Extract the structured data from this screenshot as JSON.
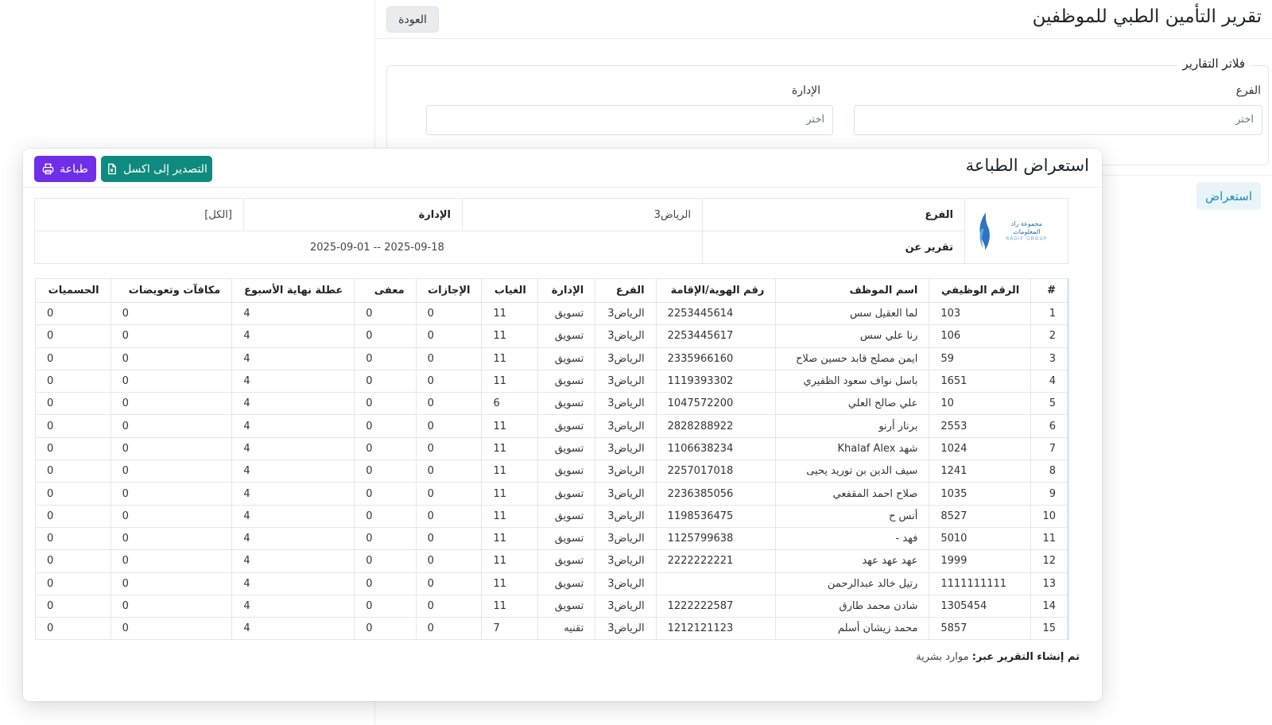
{
  "page": {
    "title": "تقرير التأمين الطبي للموظفين",
    "back_label": "العودة",
    "filters_title": "فلاتر التقارير",
    "branch_label": "الفرع",
    "branch_placeholder": "اختر",
    "department_label": "الإدارة",
    "department_placeholder": "اختر",
    "view_label": "استعراض"
  },
  "modal": {
    "title": "استعراض الطباعة",
    "export_label": "التصدير إلى اكسل",
    "print_label": "طباعة",
    "logo": {
      "line1": "مجموعة راد المعلومات",
      "line2": "RADIF GROUP"
    },
    "info": {
      "branch_label": "الفرع",
      "branch_value": "الرياض3",
      "department_label": "الإدارة",
      "department_value": "[الكل]",
      "report_for_label": "تقرير عن",
      "report_for_value": "2025-09-01 -- 2025-09-18"
    },
    "columns": [
      "#",
      "الرقم الوظيفي",
      "اسم الموظف",
      "رقم الهوية/الإقامة",
      "الفرع",
      "الإدارة",
      "الغياب",
      "الإجازات",
      "معفى",
      "عطلة نهاية الأسبوع",
      "مكافآت وتعويضات",
      "الحسميات"
    ],
    "rows": [
      [
        "1",
        "103",
        "لما العقيل سس",
        "2253445614",
        "الرياض3",
        "تسويق",
        "11",
        "0",
        "0",
        "4",
        "0",
        "0"
      ],
      [
        "2",
        "106",
        "رنا علي سس",
        "2253445617",
        "الرياض3",
        "تسويق",
        "11",
        "0",
        "0",
        "4",
        "0",
        "0"
      ],
      [
        "3",
        "59",
        "ايمن مصلح قابد حسين صلاح",
        "2335966160",
        "الرياض3",
        "تسويق",
        "11",
        "0",
        "0",
        "4",
        "0",
        "0"
      ],
      [
        "4",
        "1651",
        "باسل نواف سعود الظفيري",
        "1119393302",
        "الرياض3",
        "تسويق",
        "11",
        "0",
        "0",
        "4",
        "0",
        "0"
      ],
      [
        "5",
        "10",
        "علي صالح العلي",
        "1047572200",
        "الرياض3",
        "تسويق",
        "6",
        "0",
        "0",
        "4",
        "0",
        "0"
      ],
      [
        "6",
        "2553",
        "برنار أرنو",
        "2828288922",
        "الرياض3",
        "تسويق",
        "11",
        "0",
        "0",
        "4",
        "0",
        "0"
      ],
      [
        "7",
        "1024",
        "شهد Khalaf Alex",
        "1106638234",
        "الرياض3",
        "تسويق",
        "11",
        "0",
        "0",
        "4",
        "0",
        "0"
      ],
      [
        "8",
        "1241",
        "سيف الدين بن توريد يحيى",
        "2257017018",
        "الرياض3",
        "تسويق",
        "11",
        "0",
        "0",
        "4",
        "0",
        "0"
      ],
      [
        "9",
        "1035",
        "صلاح احمد المقفعي",
        "2236385056",
        "الرياض3",
        "تسويق",
        "11",
        "0",
        "0",
        "4",
        "0",
        "0"
      ],
      [
        "10",
        "8527",
        "أنس ح",
        "1198536475",
        "الرياض3",
        "تسويق",
        "11",
        "0",
        "0",
        "4",
        "0",
        "0"
      ],
      [
        "11",
        "5010",
        "فهد -",
        "1125799638",
        "الرياض3",
        "تسويق",
        "11",
        "0",
        "0",
        "4",
        "0",
        "0"
      ],
      [
        "12",
        "1999",
        "عهد عهد عهد",
        "2222222221",
        "الرياض3",
        "تسويق",
        "11",
        "0",
        "0",
        "4",
        "0",
        "0"
      ],
      [
        "13",
        "1111111111",
        "رتيل خالد عبدالرحمن",
        "",
        "الرياض3",
        "تسويق",
        "11",
        "0",
        "0",
        "4",
        "0",
        "0"
      ],
      [
        "14",
        "1305454",
        "شادن محمد طارق",
        "1222222587",
        "الرياض3",
        "تسويق",
        "11",
        "0",
        "0",
        "4",
        "0",
        "0"
      ],
      [
        "15",
        "5857",
        "محمد زيشان أسلم",
        "1212121123",
        "الرياض3",
        "تقنيه",
        "7",
        "0",
        "0",
        "4",
        "0",
        "0"
      ]
    ],
    "footer_label": "تم إنشاء التقرير عبر:",
    "footer_value": "موارد بشرية"
  }
}
